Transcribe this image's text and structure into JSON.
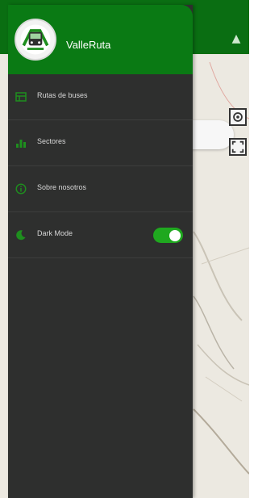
{
  "app": {
    "name": "ValleRuta"
  },
  "drawer": {
    "items": [
      {
        "label": "Rutas de buses",
        "icon": "bus-routes-icon"
      },
      {
        "label": "Sectores",
        "icon": "bar-chart-icon"
      },
      {
        "label": "Sobre nosotros",
        "icon": "info-icon"
      },
      {
        "label": "Dark Mode",
        "icon": "moon-icon",
        "toggle_on": true
      }
    ]
  },
  "colors": {
    "header_green": "#0a7a14",
    "drawer_bg": "#2e2f2e",
    "icon_green": "#1e8f1e",
    "toggle_on": "#1fa81f"
  }
}
